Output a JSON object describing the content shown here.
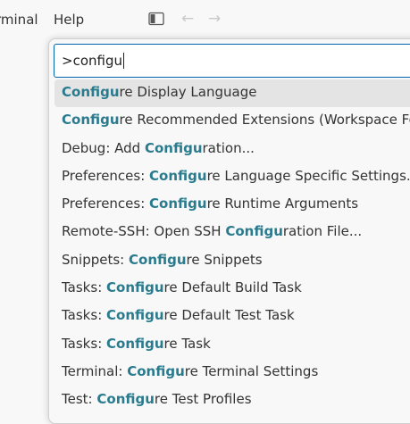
{
  "titlebar": {
    "menus": [
      "rminal",
      "Help"
    ],
    "icons": {
      "layout": "toggle-primary-sidebar-icon",
      "back": "arrow-left-icon",
      "forward": "arrow-right-icon"
    },
    "nav_back_glyph": "←",
    "nav_forward_glyph": "→"
  },
  "command_palette": {
    "input_value": ">configu",
    "items": [
      {
        "pre": "",
        "match": "Configu",
        "post": "re Display Language",
        "selected": true
      },
      {
        "pre": "",
        "match": "Configu",
        "post": "re Recommended Extensions (Workspace Fold",
        "selected": false
      },
      {
        "pre": "Debug: Add ",
        "match": "Configu",
        "post": "ration...",
        "selected": false
      },
      {
        "pre": "Preferences: ",
        "match": "Configu",
        "post": "re Language Specific Settings...",
        "selected": false
      },
      {
        "pre": "Preferences: ",
        "match": "Configu",
        "post": "re Runtime Arguments",
        "selected": false
      },
      {
        "pre": "Remote-SSH: Open SSH ",
        "match": "Configu",
        "post": "ration File...",
        "selected": false
      },
      {
        "pre": "Snippets: ",
        "match": "Configu",
        "post": "re Snippets",
        "selected": false
      },
      {
        "pre": "Tasks: ",
        "match": "Configu",
        "post": "re Default Build Task",
        "selected": false
      },
      {
        "pre": "Tasks: ",
        "match": "Configu",
        "post": "re Default Test Task",
        "selected": false
      },
      {
        "pre": "Tasks: ",
        "match": "Configu",
        "post": "re Task",
        "selected": false
      },
      {
        "pre": "Terminal: ",
        "match": "Configu",
        "post": "re Terminal Settings",
        "selected": false
      },
      {
        "pre": "Test: ",
        "match": "Configu",
        "post": "re Test Profiles",
        "selected": false
      }
    ]
  },
  "colors": {
    "match_highlight": "#2a7b8e",
    "selected_row_bg": "#e4e4e4",
    "input_border": "#0063b1",
    "text": "#333333"
  }
}
